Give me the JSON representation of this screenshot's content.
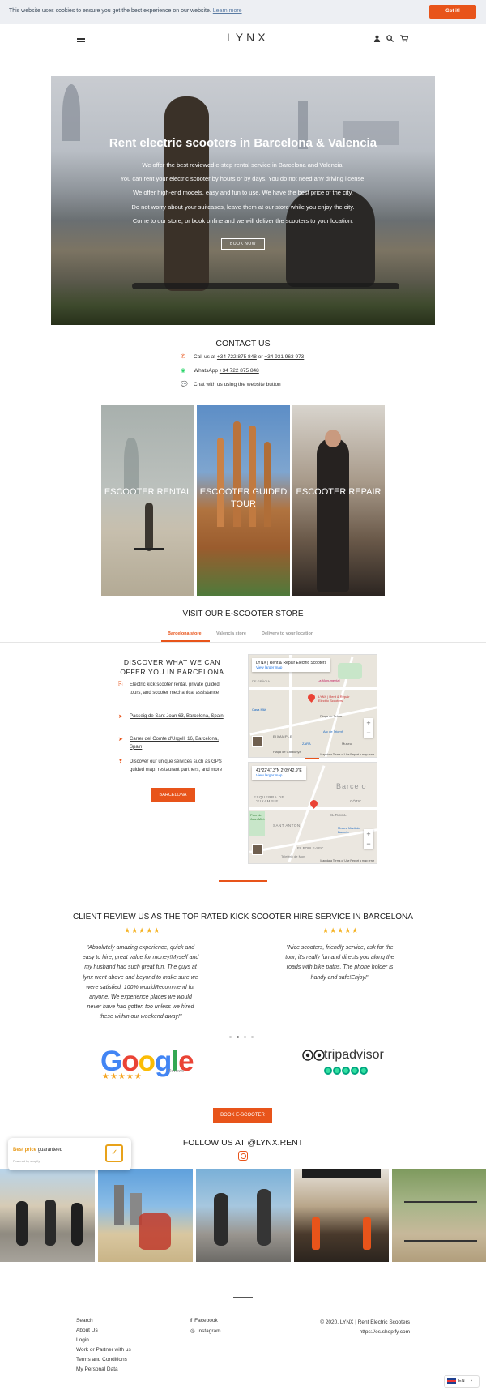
{
  "cookie_bar": {
    "message": "This website uses cookies to ensure you get the best experience on our website.",
    "learn_more": "Learn more",
    "accept": "Got it!"
  },
  "header": {
    "logo": "LYNX",
    "icons": [
      "menu-icon",
      "account-icon",
      "search-icon",
      "cart-icon"
    ]
  },
  "hero": {
    "title": "Rent electric scooters in Barcelona & Valencia",
    "lines": [
      "We offer the best reviewed e-step rental service in Barcelona and Valencia.",
      "You can rent your electric scooter by hours or by days. You do not need any driving license.",
      "We offer high-end models, easy and fun to use. We have the best price of the city.",
      "Do not worry about your suitcases, leave them at our store while you enjoy the city.",
      "Come to our store, or book online and we will deliver the scooters to your location."
    ],
    "button": "BOOK NOW"
  },
  "contact": {
    "title": "CONTACT US",
    "call_prefix": "Call us at",
    "phone1": "+34 722 875 848",
    "or": "or",
    "phone2": "+34 931 963 973",
    "whatsapp_prefix": "WhatsApp",
    "whatsapp": "+34 722 875 848",
    "chat": "Chat with us using the website button"
  },
  "services": [
    {
      "label": "ESCOOTER RENTAL"
    },
    {
      "label": "ESCOOTER GUIDED TOUR"
    },
    {
      "label": "ESCOOTER REPAIR"
    }
  ],
  "store": {
    "title": "VISIT OUR E-SCOOTER STORE",
    "tabs": [
      "Barcelona store",
      "Valencia store",
      "Delivery to your location"
    ],
    "active_tab": "Barcelona store",
    "discover_title": "DISCOVER WHAT WE CAN OFFER YOU IN BARCELONA",
    "items": [
      "Electric kick scooter rental, private guided tours, and scooter mechanical assistance",
      "Passeig de Sant Joan 63, Barcelona, Spain",
      "Carrer del Comte d'Urgell, 16, Barcelona, Spain",
      "Discover our unique services such as GPS guided map, restaurant partners, and more"
    ],
    "button": "BARCELONA",
    "map1": {
      "title": "LYNX | Rent & Repair Electric Scooters",
      "link": "View larger map",
      "pin_label": "LYNX | Rent & Repair Electric Scooters",
      "places": [
        "La Monumental",
        "Casa Milà",
        "Plaça de Tetuan",
        "EIXAMPLE",
        "Arc de Triomf",
        "ZARA",
        "Plaça de Catalunya",
        "Museu",
        "DE GRÀCIA"
      ],
      "footer": "Map data   Terms of Use   Report a map error"
    },
    "map2": {
      "title": "41°22'47.3\"N 2°09'42.9\"E",
      "link": "View larger map",
      "places": [
        "Barcelo",
        "ESQUERRA DE L'EIXAMPLE",
        "GÒTIC",
        "EL RAVAL",
        "SANT ANTONI",
        "Parc de Joan Miró",
        "Museu Marit de Barcelo",
        "EL POBLE-SEC",
        "Teleféric de Mon"
      ],
      "footer": "Map data   Terms of Use   Report a map error"
    }
  },
  "reviews": {
    "title": "CLIENT REVIEW US AS THE TOP RATED KICK SCOOTER HIRE SERVICE IN BARCELONA",
    "stars": "★★★★★",
    "left": "\"Absolutely amazing experience, quick and easy to hire, great value for money!Myself and my husband had such great fun. The guys at lynx went above and beyond to make sure we were satisfied. 100% wouldRecommend for anyone. We experience places we would never have had gotten too unless we hired these within our weekend away!\"",
    "right": "\"Nice scooters, friendly service, ask for the tour, it's really fun and directs you along the roads with bike paths. The phone holder is handy and safe!Enjoy!\"",
    "google": "Google",
    "google_sub": "Reviews",
    "tripadvisor": "tripadvisor",
    "book_button": "BOOK E-SCOOTER"
  },
  "follow": {
    "title": "FOLLOW US AT @LYNX.RENT"
  },
  "badge": {
    "best_price": "Best price",
    "guaranteed": "guaranteed",
    "powered": "Powered by shopify"
  },
  "footer": {
    "links": [
      "Search",
      "About Us",
      "Login",
      "Work or Partner with us",
      "Terms and Conditions",
      "My Personal Data"
    ],
    "social": [
      "Facebook",
      "Instagram"
    ],
    "copyright": "© 2020, LYNX | Rent Electric Scooters",
    "powered": "https://es.shopify.com",
    "language": "EN"
  },
  "colors": {
    "accent": "#e8541a",
    "stars": "#f5b324",
    "tripadvisor_green": "#34e0a1"
  }
}
